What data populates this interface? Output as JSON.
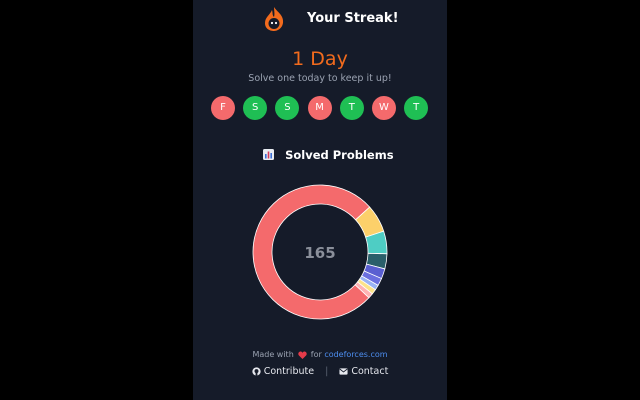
{
  "header": {
    "title": "Your Streak!",
    "logo_icon": "flame-mascot-icon"
  },
  "streak": {
    "count_text": "1 Day",
    "subtitle": "Solve one today to keep it up!",
    "accent_color": "#f26b1d"
  },
  "days": [
    {
      "letter": "F",
      "solved": false
    },
    {
      "letter": "S",
      "solved": true
    },
    {
      "letter": "S",
      "solved": true
    },
    {
      "letter": "M",
      "solved": false
    },
    {
      "letter": "T",
      "solved": true
    },
    {
      "letter": "W",
      "solved": false
    },
    {
      "letter": "T",
      "solved": true
    }
  ],
  "colors": {
    "solved": "#1fbf54",
    "unsolved": "#f46a6c",
    "background": "#151b29"
  },
  "solved_problems": {
    "title": "Solved Problems",
    "icon": "bar-chart-icon",
    "total": "165"
  },
  "chart_data": {
    "type": "pie",
    "style": "donut",
    "center_label": "165",
    "slices": [
      {
        "value": 126,
        "color": "#f46a6c"
      },
      {
        "value": 11,
        "color": "#fcd06a"
      },
      {
        "value": 9,
        "color": "#4ecdc4"
      },
      {
        "value": 6,
        "color": "#2a5f6a"
      },
      {
        "value": 4,
        "color": "#5a5fd1"
      },
      {
        "value": 3,
        "color": "#6b6fe0"
      },
      {
        "value": 2,
        "color": "#9ab3f5"
      },
      {
        "value": 2,
        "color": "#fce38a"
      },
      {
        "value": 2,
        "color": "#ffb3b3"
      }
    ]
  },
  "footer": {
    "made_with": "Made with",
    "for_text": "for",
    "site": "codeforces.com",
    "contribute": "Contribute",
    "separator": "|",
    "contact": "Contact"
  }
}
